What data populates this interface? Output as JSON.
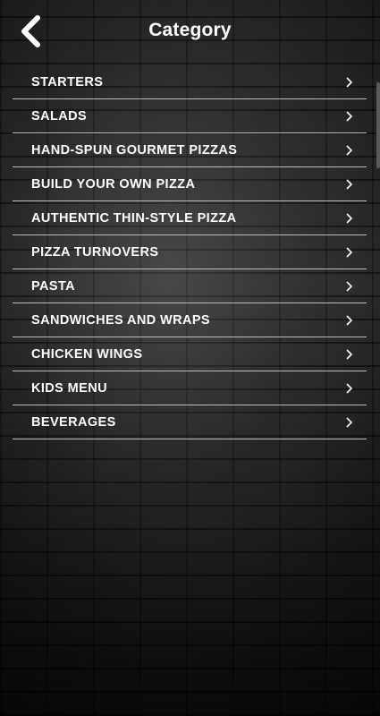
{
  "header": {
    "title": "Category",
    "back_icon": "chevron-left-icon"
  },
  "categories": [
    {
      "label": "STARTERS"
    },
    {
      "label": "SALADS"
    },
    {
      "label": "HAND-SPUN GOURMET PIZZAS"
    },
    {
      "label": "BUILD YOUR OWN PIZZA"
    },
    {
      "label": "AUTHENTIC THIN-STYLE PIZZA"
    },
    {
      "label": "PIZZA TURNOVERS"
    },
    {
      "label": "PASTA"
    },
    {
      "label": "SANDWICHES AND WRAPS"
    },
    {
      "label": "CHICKEN WINGS"
    },
    {
      "label": "KIDS MENU"
    },
    {
      "label": "BEVERAGES"
    }
  ],
  "colors": {
    "text": "#ffffff",
    "divider": "#bdbdbd",
    "background": "#1a1a1a"
  }
}
